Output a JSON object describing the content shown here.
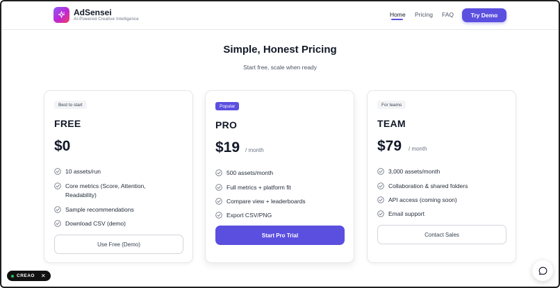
{
  "brand": {
    "name": "AdSensei",
    "tagline": "AI-Powered Creative Intelligence"
  },
  "nav": {
    "links": [
      "Home",
      "Pricing",
      "FAQ"
    ],
    "active": "Home",
    "cta": "Try Demo"
  },
  "hero": {
    "title": "Simple, Honest Pricing",
    "subtitle": "Start free, scale when ready"
  },
  "plans": [
    {
      "badge": "Best to start",
      "name": "FREE",
      "price": "$0",
      "period": "",
      "features": [
        "10 assets/run",
        "Core metrics (Score, Attention, Readability)",
        "Sample recommendations",
        "Download CSV (demo)"
      ],
      "button": "Use Free (Demo)"
    },
    {
      "badge": "Popular",
      "name": "PRO",
      "price": "$19",
      "period": "/ month",
      "features": [
        "500 assets/month",
        "Full metrics + platform fit",
        "Compare view + leaderboards",
        "Export CSV/PNG"
      ],
      "button": "Start Pro Trial"
    },
    {
      "badge": "For teams",
      "name": "TEAM",
      "price": "$79",
      "period": "/ month",
      "features": [
        "3,000 assets/month",
        "Collaboration & shared folders",
        "API access (coming soon)",
        "Email support"
      ],
      "button": "Contact Sales"
    }
  ],
  "floating": {
    "creao_label": "CREAO",
    "chat_icon": "chat-bubble-icon"
  },
  "colors": {
    "accent": "#5b4fe0",
    "check": "#6b7280"
  }
}
